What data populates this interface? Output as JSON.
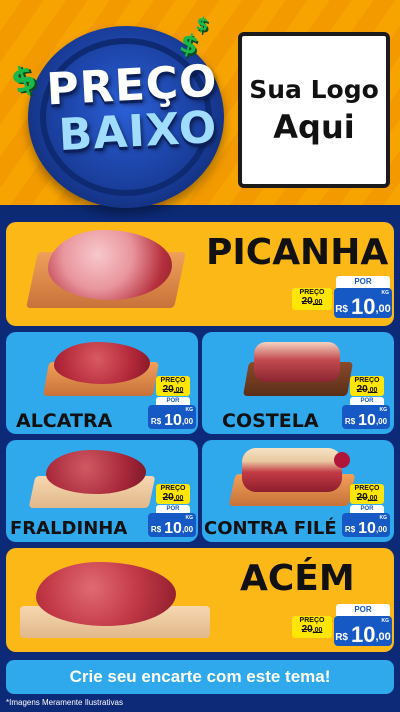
{
  "header": {
    "badge_line1": "PREÇO",
    "badge_line2": "BAIXO",
    "dollar_symbol": "$",
    "logo_line1": "Sua Logo",
    "logo_line2": "Aqui"
  },
  "price_labels": {
    "preco": "PREÇO",
    "por": "POR",
    "currency": "R$",
    "unit": "KG"
  },
  "products": [
    {
      "name": "PICANHA",
      "old_price": "20",
      "old_cents": ",00",
      "price_int": "10",
      "price_dec": ",00"
    },
    {
      "name": "ALCATRA",
      "old_price": "20",
      "old_cents": ",00",
      "price_int": "10",
      "price_dec": ",00"
    },
    {
      "name": "COSTELA",
      "old_price": "20",
      "old_cents": ",00",
      "price_int": "10",
      "price_dec": ",00"
    },
    {
      "name": "FRALDINHA",
      "old_price": "20",
      "old_cents": ",00",
      "price_int": "10",
      "price_dec": ",00"
    },
    {
      "name": "CONTRA FILÉ",
      "old_price": "20",
      "old_cents": ",00",
      "price_int": "10",
      "price_dec": ",00"
    },
    {
      "name": "ACÉM",
      "old_price": "20",
      "old_cents": ",00",
      "price_int": "10",
      "price_dec": ",00"
    }
  ],
  "cta": "Crie seu encarte com este tema!",
  "disclaimer": "*Imagens Meramente Ilustrativas",
  "colors": {
    "header_orange": "#f8a400",
    "background_navy": "#0d2a78",
    "card_yellow": "#fbb817",
    "card_blue": "#2fa8ec",
    "price_blue": "#1659c5",
    "price_yellow": "#ffe600"
  }
}
